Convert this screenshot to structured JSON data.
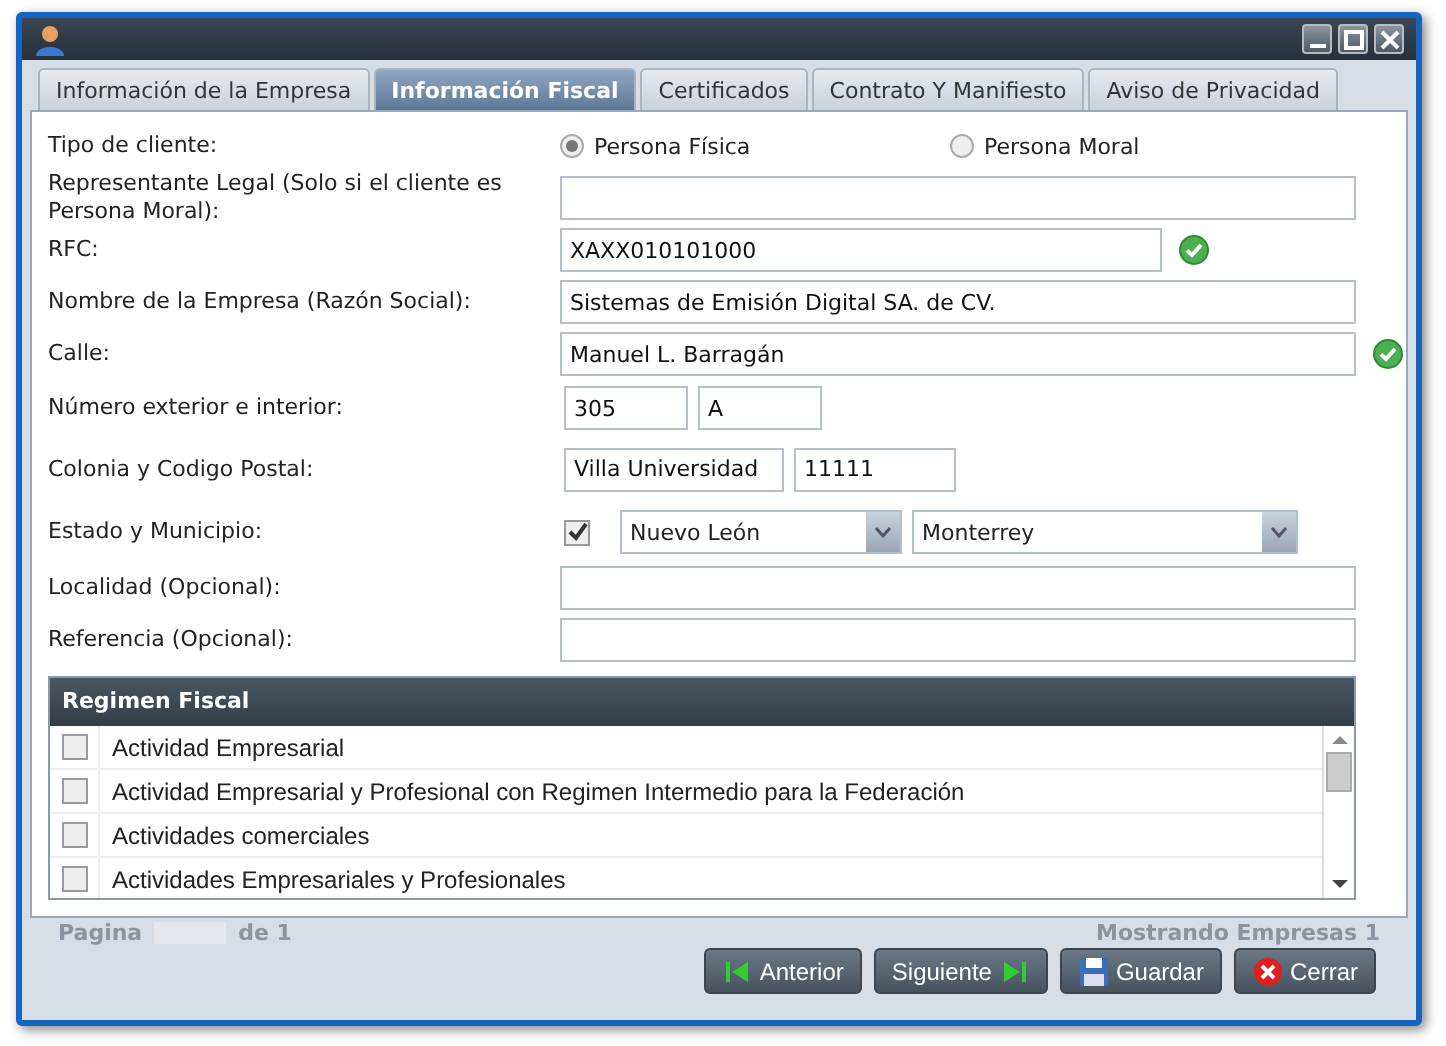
{
  "tabs": [
    {
      "label": "Información de la Empresa",
      "selected": false
    },
    {
      "label": "Información Fiscal",
      "selected": true
    },
    {
      "label": "Certificados",
      "selected": false
    },
    {
      "label": "Contrato Y Manifiesto",
      "selected": false
    },
    {
      "label": "Aviso de Privacidad",
      "selected": false
    }
  ],
  "form": [
    {
      "kind": "radio",
      "label": "Tipo de cliente:",
      "options": [
        {
          "label": "Persona Física",
          "selected": true
        },
        {
          "label": "Persona Moral",
          "selected": false
        }
      ]
    },
    {
      "kind": "text",
      "label": "Representante Legal (Solo si el cliente es Persona Moral):",
      "valid": false
    },
    {
      "kind": "short",
      "label": "RFC:",
      "values": [
        "XAXX010101000"
      ],
      "valid": true
    },
    {
      "kind": "text",
      "label": "Nombre de la Empresa (Razón Social):",
      "values": [
        "Sistemas de Emisión Digital SA. de CV."
      ],
      "valid": false
    },
    {
      "kind": "text",
      "label": "Calle:",
      "values": [
        "Manuel L. Barragán"
      ],
      "valid": true
    },
    {
      "kind": "numbers",
      "label": "Número exterior e interior:",
      "values": [
        "305",
        "A"
      ],
      "valid": false
    },
    {
      "kind": "address",
      "label": "Colonia y Codigo Postal:",
      "values": [
        "Villa Universidad",
        "11111"
      ],
      "valid": false
    },
    {
      "kind": "combo",
      "label": "Estado y Municipio:",
      "checked": true,
      "values": [
        "Nuevo León",
        "Monterrey"
      ]
    },
    {
      "kind": "text",
      "label": "Localidad (Opcional):",
      "valid": false
    },
    {
      "kind": "text",
      "label": "Referencia (Opcional):",
      "valid": false
    }
  ],
  "regimen": {
    "title": "Regimen Fiscal",
    "items": [
      {
        "label": "Actividad Empresarial",
        "checked": false
      },
      {
        "label": "Actividad Empresarial y Profesional con Regimen Intermedio para la Federación",
        "checked": false
      },
      {
        "label": "Actividades comerciales",
        "checked": false
      },
      {
        "label": "Actividades Empresariales y Profesionales",
        "checked": false
      }
    ]
  },
  "background_pager": {
    "page": "Pagina",
    "of": "de 1",
    "showing": "Mostrando Empresas 1"
  },
  "buttons": [
    {
      "label": "Anterior",
      "kind": "prev"
    },
    {
      "label": "Siguiente",
      "kind": "next"
    },
    {
      "label": "Guardar",
      "kind": "save"
    },
    {
      "label": "Cerrar",
      "kind": "close"
    }
  ]
}
